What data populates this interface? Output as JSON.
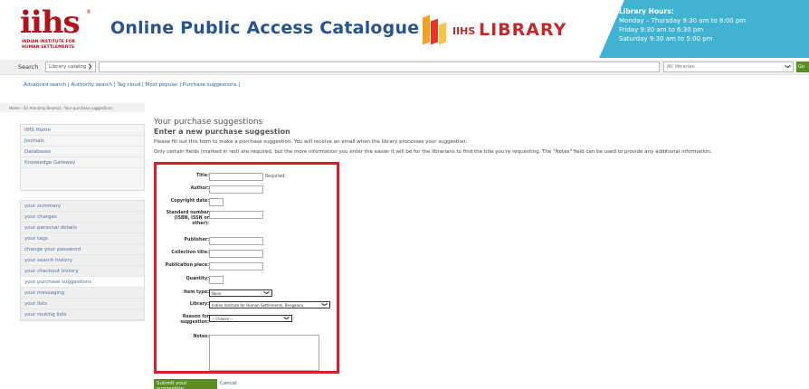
{
  "header": {
    "logo_text": "iihs",
    "logo_reg": "®",
    "logo_sub": "INDIAN INSTITUTE FOR HUMAN SETTLEMENTS",
    "title": "Online Public Access Catalogue",
    "library_logo_iihs": "IIHS",
    "library_logo_library": "LIBRARY",
    "hours": {
      "title": "Library Hours:",
      "line1": "Monday – Thursday 9:30 am to 8:00 pm",
      "line2": "Friday 9:30 am to 6:30 pm",
      "line3": "Saturday 9:30 am to 5:00 pm"
    }
  },
  "search": {
    "label": "Search",
    "catalog_select": "Library catalog",
    "query": "",
    "library_select": "All libraries",
    "go_label": "Go"
  },
  "links": "Advanced search | Authority search | Tag cloud | Most popular | Purchase suggestions |",
  "breadcrumb": "Home › Sri Amrutraj Beneral › Your purchase suggestions",
  "sidenav_top": [
    "IIHS Home",
    "Journals",
    "Databases",
    "Knowledge Gateway"
  ],
  "sidenav_user": [
    "your summary",
    "your charges",
    "your personal details",
    "your tags",
    "change your password",
    "your search history",
    "your checkout history",
    "your purchase suggestions",
    "your messaging",
    "your lists",
    "your routing lists"
  ],
  "main": {
    "heading": "Your purchase suggestions",
    "subheading": "Enter a new purchase suggestion",
    "intro": "Please fill out this form to make a purchase suggestion. You will receive an email when the library processes your suggestion.",
    "note": "Only certain fields (marked in red) are required, but the more information you enter the easier it will be for the librarians to find the title you're requesting. The \"Notes\" field can be used to provide any additional information."
  },
  "form": {
    "title_label": "Title:",
    "required_text": "Required",
    "author_label": "Author:",
    "copyright_label": "Copyright date:",
    "standard_label": "Standard number (ISBN, ISSN or other):",
    "publisher_label": "Publisher:",
    "collection_label": "Collection title:",
    "place_label": "Publication place:",
    "quantity_label": "Quantity:",
    "itemtype_label": "Item type:",
    "itemtype_value": "None",
    "library_label": "Library:",
    "library_value": "Indian Institute for Human Settlements, Bengaluru",
    "reason_label": "Reason for suggestion:",
    "reason_value": "-- Choose --",
    "notes_label": "Notes:"
  },
  "actions": {
    "submit": "Submit your suggestion",
    "cancel": "Cancel"
  }
}
